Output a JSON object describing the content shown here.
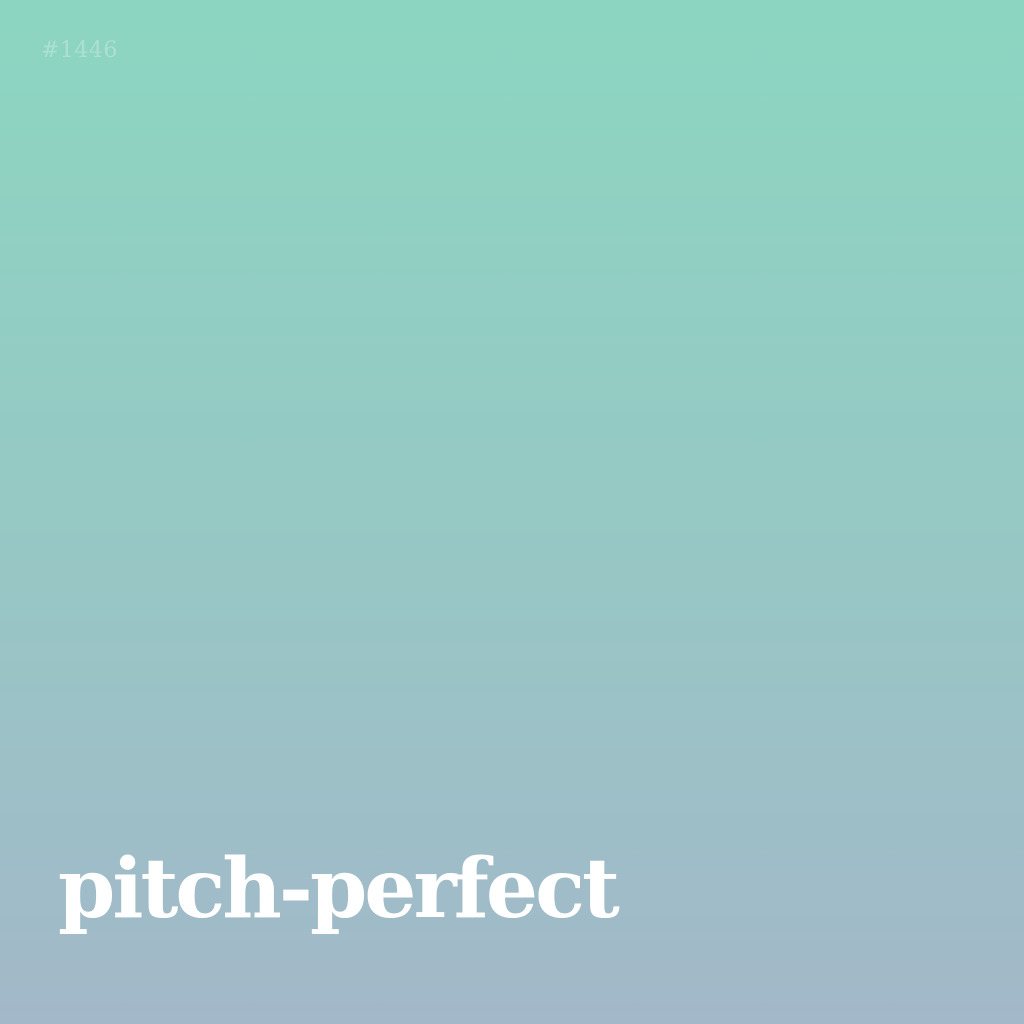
{
  "card": {
    "index": "#1446",
    "word": "pitch-perfect"
  },
  "colors": {
    "gradient_top": "#8cd6c1",
    "gradient_middle": "#96c8c4",
    "gradient_bottom": "#a3b8c9",
    "text": "#ffffff"
  }
}
